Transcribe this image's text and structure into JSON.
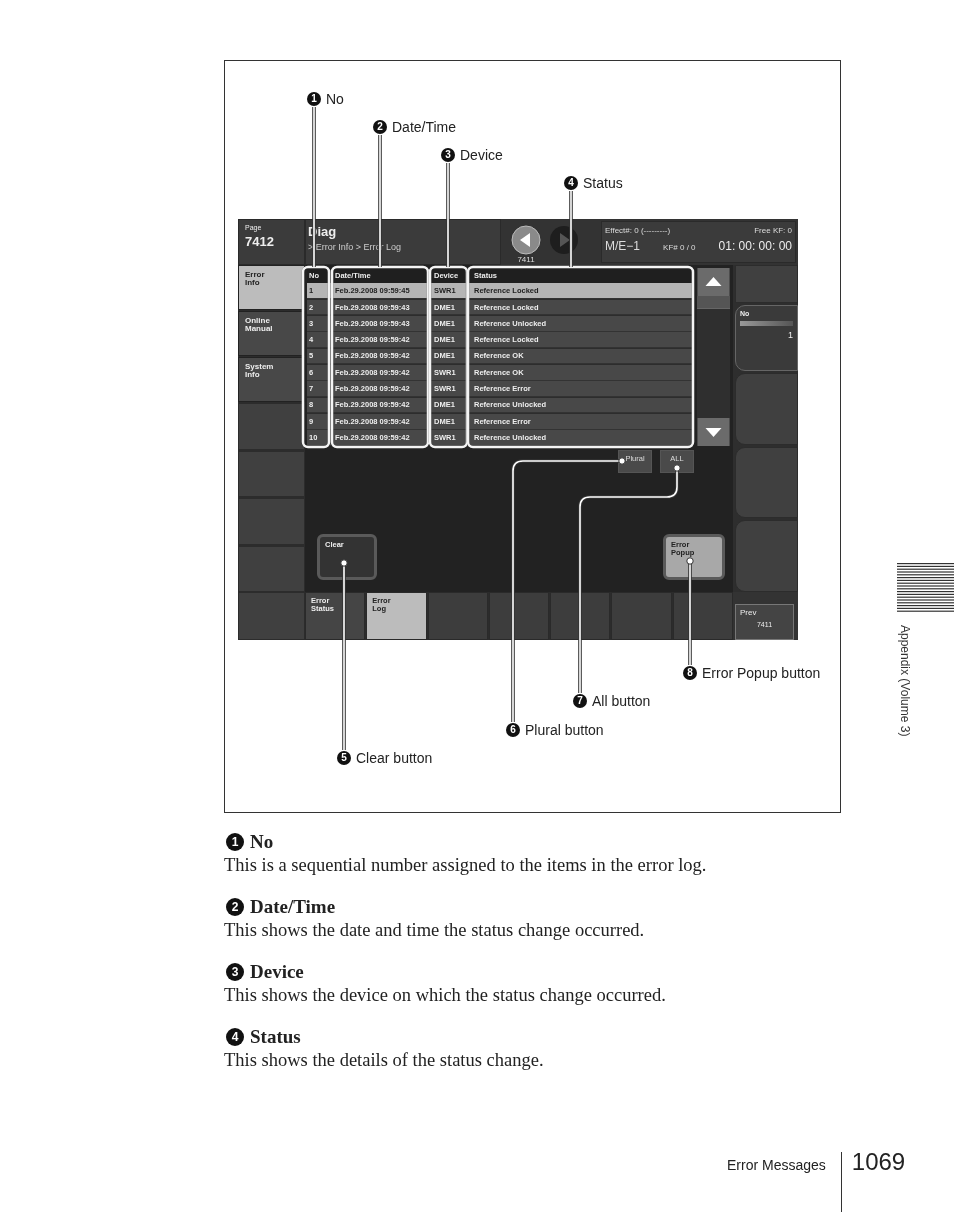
{
  "figure": {
    "screen": {
      "page": {
        "label": "Page",
        "number": "7412"
      },
      "title": "Diag",
      "breadcrumb": "> Error Info > Error Log",
      "nav": {
        "prev_page": "7411"
      },
      "info": {
        "effect": "Effect#: 0 (---------)",
        "free_kf": "Free KF: 0",
        "me": "M/E−1",
        "kf": "KF# 0 / 0",
        "timecode": "01: 00: 00: 00"
      },
      "side_tabs": [
        {
          "label": "Error\nInfo",
          "selected": true
        },
        {
          "label": "Online\nManual",
          "selected": false
        },
        {
          "label": "System\nInfo",
          "selected": false
        }
      ],
      "table": {
        "columns": [
          "No",
          "Date/Time",
          "Device",
          "Status"
        ],
        "rows": [
          {
            "cells": [
              "1",
              "Feb.29.2008 09:59:45",
              "SWR1",
              "Reference Locked"
            ],
            "selected": true
          },
          {
            "cells": [
              "2",
              "Feb.29.2008 09:59:43",
              "DME1",
              "Reference Locked"
            ],
            "selected": false
          },
          {
            "cells": [
              "3",
              "Feb.29.2008 09:59:43",
              "DME1",
              "Reference Unlocked"
            ],
            "selected": false
          },
          {
            "cells": [
              "4",
              "Feb.29.2008 09:59:42",
              "DME1",
              "Reference Locked"
            ],
            "selected": false
          },
          {
            "cells": [
              "5",
              "Feb.29.2008 09:59:42",
              "DME1",
              "Reference OK"
            ],
            "selected": false
          },
          {
            "cells": [
              "6",
              "Feb.29.2008 09:59:42",
              "SWR1",
              "Reference OK"
            ],
            "selected": false
          },
          {
            "cells": [
              "7",
              "Feb.29.2008 09:59:42",
              "SWR1",
              "Reference Error"
            ],
            "selected": false
          },
          {
            "cells": [
              "8",
              "Feb.29.2008 09:59:42",
              "DME1",
              "Reference Unlocked"
            ],
            "selected": false
          },
          {
            "cells": [
              "9",
              "Feb.29.2008 09:59:42",
              "DME1",
              "Reference Error"
            ],
            "selected": false
          },
          {
            "cells": [
              "10",
              "Feb.29.2008 09:59:42",
              "SWR1",
              "Reference Unlocked"
            ],
            "selected": false
          }
        ]
      },
      "plural_button": "Plural",
      "all_button": "ALL",
      "clear_button": "Clear",
      "error_popup_button": "Error\nPopup",
      "bottom_tabs": [
        {
          "label": "Error\nStatus",
          "selected": false
        },
        {
          "label": "Error\nLog",
          "selected": true
        }
      ],
      "no_field": {
        "label": "No",
        "value": "1"
      },
      "prev_button": {
        "label": "Prev",
        "page": "7411"
      }
    },
    "callouts": [
      {
        "number": "1",
        "label": "No"
      },
      {
        "number": "2",
        "label": "Date/Time"
      },
      {
        "number": "3",
        "label": "Device"
      },
      {
        "number": "4",
        "label": "Status"
      },
      {
        "number": "5",
        "label": "Clear button"
      },
      {
        "number": "6",
        "label": "Plural button"
      },
      {
        "number": "7",
        "label": "All button"
      },
      {
        "number": "8",
        "label": "Error Popup button"
      }
    ]
  },
  "descriptions": [
    {
      "number": "1",
      "title": "No",
      "text": "This is a sequential number assigned to the items in the error log."
    },
    {
      "number": "2",
      "title": "Date/Time",
      "text": "This shows the date and time the status change occurred."
    },
    {
      "number": "3",
      "title": "Device",
      "text": "This shows the device on which the status change occurred."
    },
    {
      "number": "4",
      "title": "Status",
      "text": "This shows the details of the status change."
    }
  ],
  "side_label": "Appendix (Volume 3)",
  "footer": {
    "section": "Error Messages",
    "page": "1069"
  }
}
